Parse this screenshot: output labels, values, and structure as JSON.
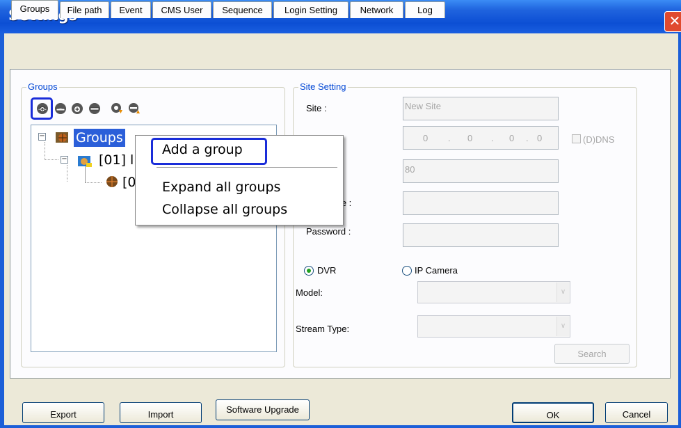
{
  "window": {
    "title": "Settings",
    "close_glyph": "✕"
  },
  "tabs": [
    "Groups",
    "File path",
    "Event",
    "CMS User",
    "Sequence",
    "Login Setting",
    "Network",
    "Log"
  ],
  "groups_panel": {
    "label": "Groups",
    "toolbar_icons": [
      "add-group-icon",
      "remove-group-icon",
      "add-site-icon",
      "remove-site-icon",
      "move-in-icon",
      "move-out-icon"
    ],
    "tree": {
      "root": "Groups",
      "child": "[01] l",
      "grandchild": "[0"
    }
  },
  "context_menu": {
    "items": [
      "Add a group",
      "Expand all groups",
      "Collapse all groups"
    ]
  },
  "site_setting": {
    "label": "Site Setting",
    "site_label": "Site :",
    "site_value": "New Site",
    "ip_octets": [
      "0",
      "0",
      "0",
      "0"
    ],
    "ip_separator": ".",
    "ddns_label": "(D)DNS",
    "port_value": "80",
    "username_label_partial": "me :",
    "password_label": "Password :",
    "dvr_label": "DVR",
    "ipcam_label": "IP Camera",
    "model_label": "Model:",
    "stream_label": "Stream Type:",
    "search_label": "Search"
  },
  "buttons": {
    "export": "Export",
    "import": "Import",
    "upgrade": "Software Upgrade",
    "ok": "OK",
    "cancel": "Cancel"
  },
  "colors": {
    "titlebar": "#0c4fd4",
    "highlight": "#2b5fd9",
    "annotation": "#1a2dd9"
  }
}
